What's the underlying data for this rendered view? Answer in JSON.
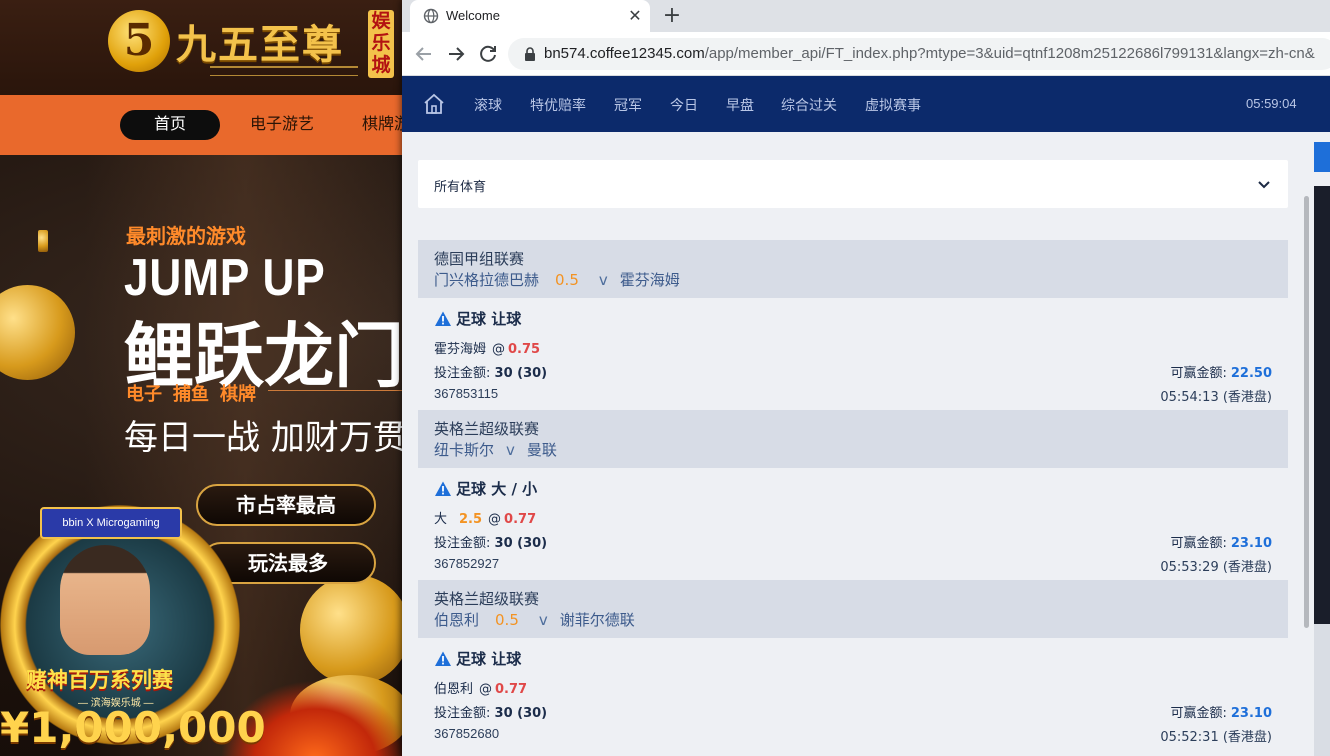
{
  "background_site": {
    "logo_text": "九五至尊",
    "logo_badge": "娱乐城",
    "nav": [
      "首页",
      "电子游艺",
      "棋牌游"
    ],
    "hero": {
      "kicker": "最刺激的游戏",
      "headline_en": "JUMP UP",
      "headline_cn": "鲤跃龙门",
      "categories": "电子 捕鱼 棋牌",
      "slogan": "每日一战  加财万贯"
    },
    "pills": [
      "市占率最高",
      "玩法最多"
    ],
    "promo": {
      "partner": "bbin X Microgaming",
      "title": "赌神百万系列赛",
      "subtitle": "— 滨海娱乐城 —",
      "amount": "¥1,000,000"
    }
  },
  "browser": {
    "tab_title": "Welcome",
    "url_host": "bn574.coffee12345.com",
    "url_path": "/app/member_api/FT_index.php?mtype=3&uid=qtnf1208m25122686l799131&langx=zh-cn&"
  },
  "app": {
    "nav": [
      "滚球",
      "特优赔率",
      "冠军",
      "今日",
      "早盘",
      "综合过关",
      "虚拟赛事"
    ],
    "clock": "05:59:04",
    "sport_filter": "所有体育"
  },
  "bets": [
    {
      "league": "德国甲组联赛",
      "home": "门兴格拉德巴赫",
      "handicap": "0.5",
      "vs": "v",
      "away": "霍芬海姆",
      "bet_type": "足球 让球",
      "selection": "霍芬海姆",
      "selection_line": "",
      "odds": "0.75",
      "stake_label": "投注金额:",
      "stake": "30 (30)",
      "win_label": "可赢金额:",
      "win": "22.50",
      "ticket_id": "367853115",
      "time": "05:54:13 (香港盘)"
    },
    {
      "league": "英格兰超级联赛",
      "home": "纽卡斯尔",
      "handicap": "",
      "vs": "v",
      "away": "曼联",
      "bet_type": "足球 大 / 小",
      "selection": "大",
      "selection_line": "2.5",
      "odds": "0.77",
      "stake_label": "投注金额:",
      "stake": "30 (30)",
      "win_label": "可赢金额:",
      "win": "23.10",
      "ticket_id": "367852927",
      "time": "05:53:29 (香港盘)"
    },
    {
      "league": "英格兰超级联赛",
      "home": "伯恩利",
      "handicap": "0.5",
      "vs": "v",
      "away": "谢菲尔德联",
      "bet_type": "足球 让球",
      "selection": "伯恩利",
      "selection_line": "",
      "odds": "0.77",
      "stake_label": "投注金额:",
      "stake": "30 (30)",
      "win_label": "可赢金额:",
      "win": "23.10",
      "ticket_id": "367852680",
      "time": "05:52:31 (香港盘)"
    }
  ],
  "colors": {
    "appbar": "#0c2a6b",
    "handicap": "#f39323",
    "odds": "#e04848",
    "win_amount": "#1e6fd9",
    "site_nav": "#e9692c"
  }
}
